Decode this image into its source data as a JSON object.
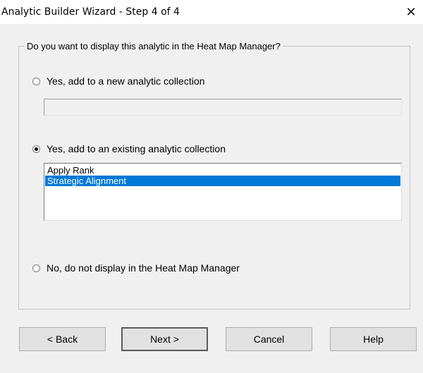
{
  "window": {
    "title": "Analytic Builder Wizard - Step 4 of 4",
    "close_glyph": "✕"
  },
  "group": {
    "legend": "Do you want to display this analytic in the Heat Map Manager?"
  },
  "options": {
    "new_collection": {
      "label": "Yes, add to a new analytic collection",
      "selected": false
    },
    "existing_collection": {
      "label": "Yes, add to an existing analytic collection",
      "selected": true
    },
    "do_not_display": {
      "label": "No, do not display in the Heat Map Manager",
      "selected": false
    }
  },
  "new_collection_input": {
    "value": ""
  },
  "collections_list": [
    {
      "label": "Apply Rank",
      "selected": false
    },
    {
      "label": "Strategic Alignment",
      "selected": true
    }
  ],
  "buttons": {
    "back": "< Back",
    "next": "Next >",
    "cancel": "Cancel",
    "help": "Help"
  }
}
